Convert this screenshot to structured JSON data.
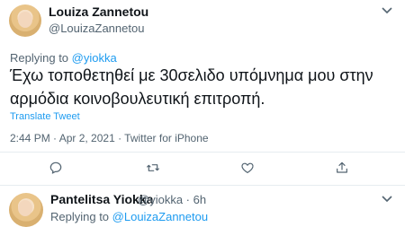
{
  "main_tweet": {
    "author_name": "Louiza Zannetou",
    "author_handle": "@LouizaZannetou",
    "replying_prefix": "Replying to ",
    "replying_to": "@yiokka",
    "text": "Έχω τοποθετηθεί με 30σελιδο υπόμνημα μου στην αρμόδια κοινοβουλευτική επιτροπή.",
    "translate_label": "Translate Tweet",
    "meta": "2:44 PM · Apr 2, 2021 · Twitter for iPhone"
  },
  "actions": {
    "reply_icon": "reply-icon",
    "retweet_icon": "retweet-icon",
    "like_icon": "heart-icon",
    "share_icon": "share-icon"
  },
  "reply_tweet": {
    "author_name": "Pantelitsa Yiokka",
    "author_handle": "@yiokka · 6h",
    "replying_prefix": "Replying to ",
    "replying_to": "@LouizaZannetou"
  },
  "colors": {
    "accent": "#1d9bf0",
    "secondary_text": "#536471",
    "divider": "#e6ecf0"
  }
}
